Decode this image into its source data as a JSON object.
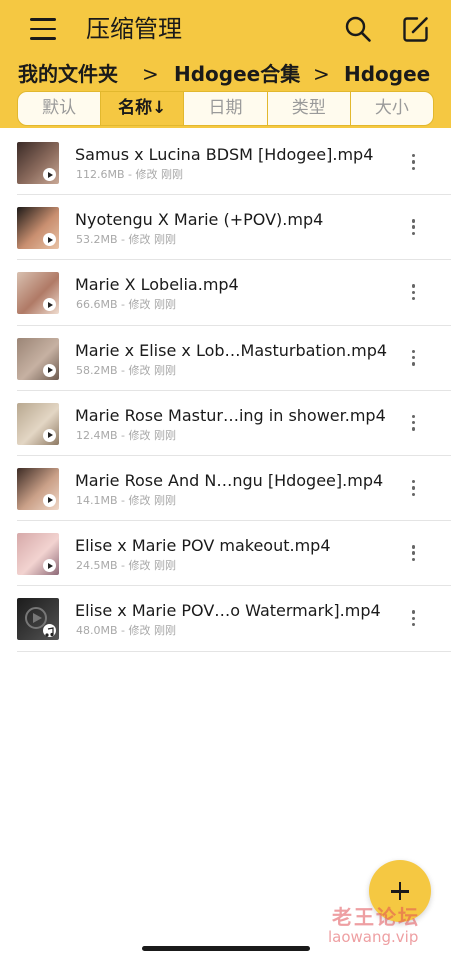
{
  "app": {
    "title": "压缩管理"
  },
  "breadcrumb": [
    {
      "label": "我的文件夹"
    },
    {
      "label": "Hdogee合集"
    },
    {
      "label": "Hdogee"
    }
  ],
  "breadcrumb_separator": ">",
  "sort_tabs": [
    {
      "label": "默认",
      "active": false
    },
    {
      "label": "名称↓",
      "active": true
    },
    {
      "label": "日期",
      "active": false
    },
    {
      "label": "类型",
      "active": false
    },
    {
      "label": "大小",
      "active": false
    }
  ],
  "files": [
    {
      "name": "Samus x Lucina BDSM [Hdogee].mp4",
      "meta": "112.6MB - 修改 刚刚",
      "badge": "play",
      "thumb_colors": [
        "#3a2a26",
        "#8a6a5c",
        "#c9a896"
      ]
    },
    {
      "name": "Nyotengu X Marie (+POV).mp4",
      "meta": "53.2MB - 修改 刚刚",
      "badge": "play",
      "thumb_colors": [
        "#1e1a18",
        "#c98f70",
        "#e9c3a6"
      ]
    },
    {
      "name": "Marie X Lobelia.mp4",
      "meta": "66.6MB - 修改 刚刚",
      "badge": "play",
      "thumb_colors": [
        "#d8c0b0",
        "#b07a66",
        "#f0ddd0"
      ]
    },
    {
      "name": "Marie x Elise x Lob…Masturbation.mp4",
      "meta": "58.2MB - 修改 刚刚",
      "badge": "play",
      "thumb_colors": [
        "#9b8576",
        "#c6b1a2",
        "#6d5b50"
      ]
    },
    {
      "name": "Marie Rose Mastur…ing in shower.mp4",
      "meta": "12.4MB - 修改 刚刚",
      "badge": "play",
      "thumb_colors": [
        "#b8a890",
        "#e3d6c4",
        "#8e7a64"
      ]
    },
    {
      "name": "Marie Rose And N…ngu [Hdogee].mp4",
      "meta": "14.1MB - 修改 刚刚",
      "badge": "play",
      "thumb_colors": [
        "#3c2b25",
        "#caa088",
        "#f0d8c8"
      ]
    },
    {
      "name": "Elise x Marie POV makeout.mp4",
      "meta": "24.5MB - 修改 刚刚",
      "badge": "play",
      "thumb_colors": [
        "#d6a9a9",
        "#f2d3d0",
        "#8e6a78"
      ]
    },
    {
      "name": "Elise x Marie POV…o Watermark].mp4",
      "meta": "48.0MB - 修改 刚刚",
      "badge": "music",
      "thumb_colors": [
        "#1c1c1c",
        "#3a3a3a",
        "#555555"
      ]
    }
  ],
  "watermark": {
    "cn": "老王论坛",
    "en": "laowang.vip"
  },
  "colors": {
    "accent": "#f5c842",
    "accent_border": "#e2b82e",
    "text": "#1a1a1a",
    "meta_text": "#a8a8a8",
    "watermark": "#e05055"
  },
  "icons": {
    "menu": "menu-icon",
    "search": "search-icon",
    "edit": "edit-icon",
    "more": "more-vertical-icon",
    "add": "plus-icon"
  }
}
